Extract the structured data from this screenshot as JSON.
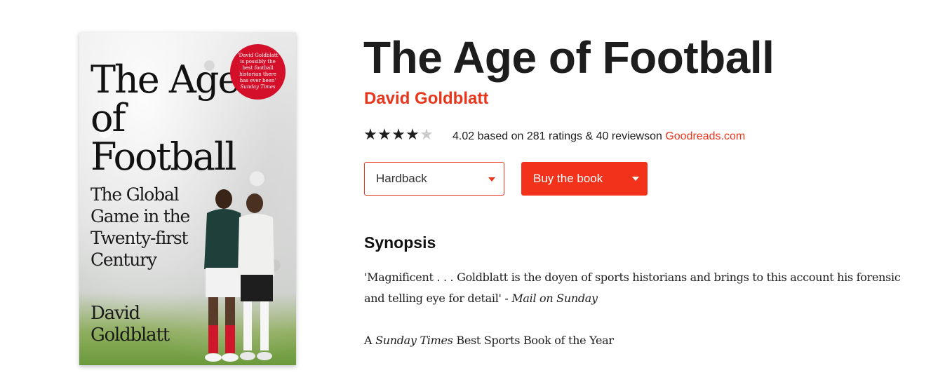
{
  "cover": {
    "title": "The Age of Football",
    "subtitle": "The Global Game in the Twenty-first Century",
    "author": "David Goldblatt",
    "badge_quote": "'David Goldblatt is possibly the best football historian there has ever been'",
    "badge_source": "Sunday Times"
  },
  "book": {
    "title": "The Age of Football",
    "author": "David Goldblatt"
  },
  "rating": {
    "stars_filled": 4,
    "stars_total": 5,
    "text": "4.02 based on 281 ratings & 40 reviewson",
    "source_link": "Goodreads.com"
  },
  "actions": {
    "format_selected": "Hardback",
    "buy_label": "Buy the book"
  },
  "synopsis": {
    "heading": "Synopsis",
    "quote": "'Magnificent . . . Goldblatt is the doyen of sports historians and brings to this account his forensic and telling eye for detail' -",
    "quote_source": "Mail on Sunday",
    "award_prefix": "A",
    "award_publication": "Sunday Times",
    "award_suffix": "Best Sports Book of the Year"
  },
  "colors": {
    "accent": "#e8361c",
    "button": "#f2321a",
    "text": "#1d1d1d"
  }
}
